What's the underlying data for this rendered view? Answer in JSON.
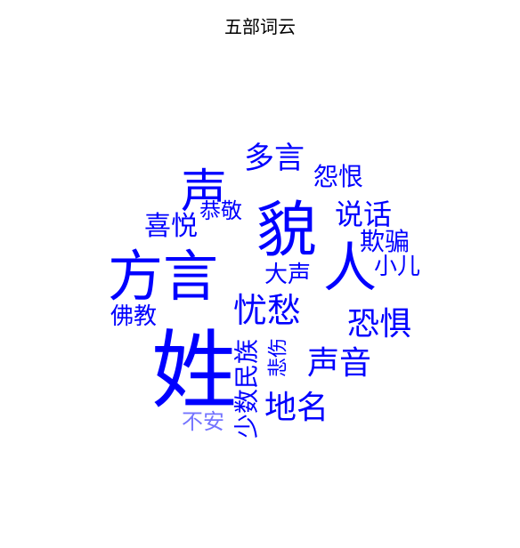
{
  "chart_data": {
    "type": "wordcloud",
    "title": "五部词云",
    "color": "#0000ff",
    "words": [
      {
        "text": "姓",
        "weight": 100
      },
      {
        "text": "貌",
        "weight": 75
      },
      {
        "text": "方言",
        "weight": 70
      },
      {
        "text": "人",
        "weight": 68
      },
      {
        "text": "声",
        "weight": 60
      },
      {
        "text": "忧愁",
        "weight": 48
      },
      {
        "text": "地名",
        "weight": 46
      },
      {
        "text": "声音",
        "weight": 45
      },
      {
        "text": "恐惧",
        "weight": 43
      },
      {
        "text": "多言",
        "weight": 42
      },
      {
        "text": "说话",
        "weight": 40
      },
      {
        "text": "少数民族",
        "weight": 38
      },
      {
        "text": "喜悦",
        "weight": 36
      },
      {
        "text": "欺骗",
        "weight": 35
      },
      {
        "text": "小儿",
        "weight": 34
      },
      {
        "text": "怨恨",
        "weight": 34
      },
      {
        "text": "大声",
        "weight": 33
      },
      {
        "text": "佛教",
        "weight": 32
      },
      {
        "text": "恭敬",
        "weight": 30
      },
      {
        "text": "不安",
        "weight": 29
      },
      {
        "text": "悲伤",
        "weight": 27
      }
    ]
  }
}
